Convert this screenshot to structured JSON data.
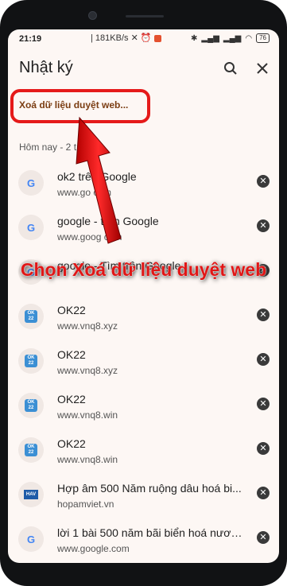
{
  "status_bar": {
    "time": "21:19",
    "speed": "181KB/s",
    "battery": "76"
  },
  "app_bar": {
    "title": "Nhật ký"
  },
  "clear_link": "Xoá dữ liệu duyệt web...",
  "date_header": "Hôm nay - 2 t       2025",
  "history": [
    {
      "title": "ok2      trên Google",
      "url": "www.go     com",
      "icon": "google-icon"
    },
    {
      "title": "google -      trên Google",
      "url": "www.goog     com",
      "icon": "google-icon"
    },
    {
      "title": "google - Tìm trên Google",
      "url": "",
      "icon": "google-icon"
    },
    {
      "title": "OK22",
      "url": "www.vnq8.xyz",
      "icon": "ok22-icon"
    },
    {
      "title": "OK22",
      "url": "www.vnq8.xyz",
      "icon": "ok22-icon"
    },
    {
      "title": "OK22",
      "url": "www.vnq8.win",
      "icon": "ok22-icon"
    },
    {
      "title": "OK22",
      "url": "www.vnq8.win",
      "icon": "ok22-icon"
    },
    {
      "title": "Hợp âm 500 Năm ruộng dâu hoá bi...",
      "url": "hopamviet.vn",
      "icon": "hav-icon"
    },
    {
      "title": "lời 1 bài 500 năm bãi biển hoá nươn...",
      "url": "www.google.com",
      "icon": "google-icon"
    }
  ],
  "annotation": "Chọn Xoá dữ liệu duyệt web",
  "colors": {
    "annotation_red": "#e01616",
    "link_brown": "#7b3d12"
  }
}
